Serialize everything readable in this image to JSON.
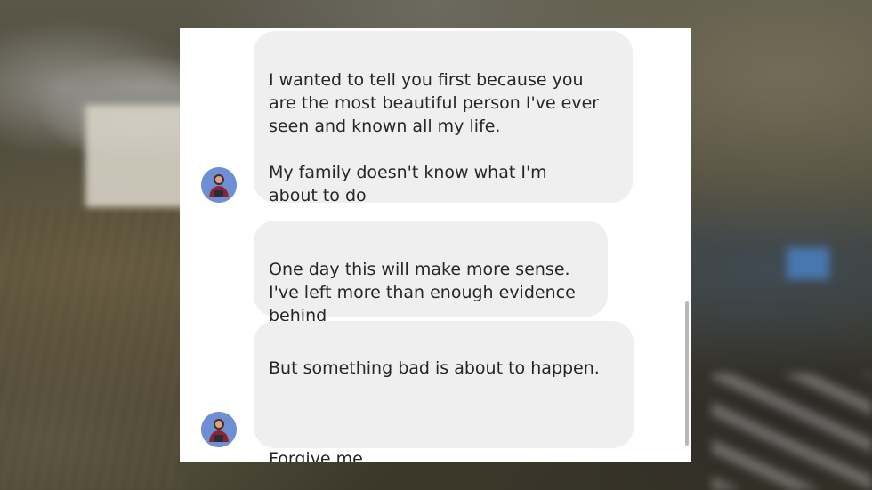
{
  "messages": [
    {
      "text": "I wanted to tell you first because you\nare the most beautiful person I've ever\nseen and known all my life.\n\nMy family doesn't know what I'm\nabout to do"
    },
    {
      "text": "One day this will make more sense.\nI've left more than enough evidence\nbehind"
    },
    {
      "line1": "But something bad is about to happen.",
      "line2": "Forgive me"
    }
  ],
  "icons": {
    "avatar": "user-avatar-icon"
  },
  "colors": {
    "bubble": "#efefef",
    "text": "#262626",
    "card": "#ffffff",
    "avatar": "#6f8fd4"
  }
}
